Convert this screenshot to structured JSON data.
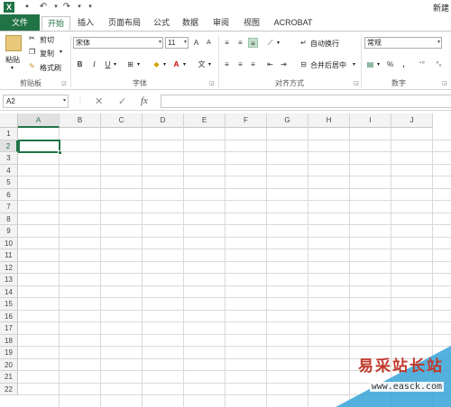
{
  "titlebar": {
    "app_icon": "X",
    "save_icon": "save-icon",
    "undo_icon": "undo-icon",
    "redo_icon": "redo-icon",
    "new_label": "新建"
  },
  "tabs": [
    "文件",
    "开始",
    "插入",
    "页面布局",
    "公式",
    "数据",
    "审阅",
    "视图",
    "ACROBAT"
  ],
  "ribbon": {
    "clipboard": {
      "paste": "粘贴",
      "cut": "剪切",
      "copy": "复制",
      "format_painter": "格式刷",
      "label": "剪贴板"
    },
    "font": {
      "name": "宋体",
      "size": "11",
      "grow": "A",
      "shrink": "A",
      "bold": "B",
      "italic": "I",
      "underline": "U",
      "label": "字体"
    },
    "alignment": {
      "wrap": "自动换行",
      "merge": "合并后居中",
      "label": "对齐方式"
    },
    "number": {
      "format": "常规",
      "percent": "%",
      "comma": ",",
      "label": "数字"
    }
  },
  "formula_bar": {
    "name_box": "A2",
    "cancel": "✕",
    "enter": "✓",
    "fx": "fx",
    "value": ""
  },
  "sheet": {
    "columns": [
      "A",
      "B",
      "C",
      "D",
      "E",
      "F",
      "G",
      "H",
      "I",
      "J"
    ],
    "rows": [
      "1",
      "2",
      "3",
      "4",
      "5",
      "6",
      "7",
      "8",
      "9",
      "10",
      "11",
      "12",
      "13",
      "14",
      "15",
      "16",
      "17",
      "18",
      "19",
      "20",
      "21",
      "22"
    ],
    "selected_cell": "A2"
  },
  "watermark": {
    "name": "易采站长站",
    "url": "www.easck.com"
  },
  "colors": {
    "accent": "#217346",
    "watermark_red": "#c0392b",
    "watermark_blue": "#36a3d8"
  }
}
